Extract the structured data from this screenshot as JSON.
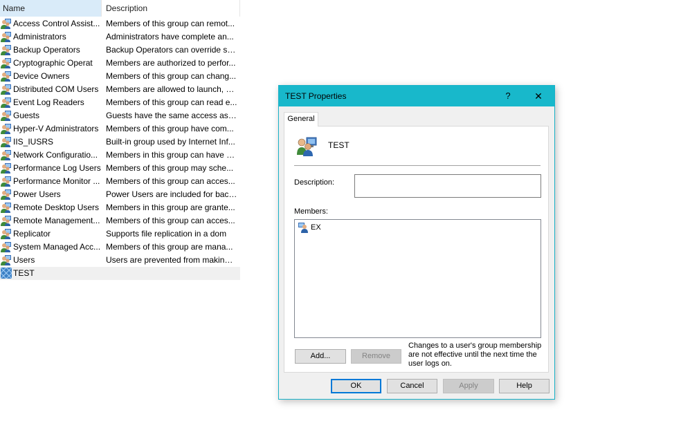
{
  "list": {
    "columns": {
      "name": "Name",
      "description": "Description"
    },
    "rows": [
      {
        "name": "Access Control Assist...",
        "description": "Members of this group can remot..."
      },
      {
        "name": "Administrators",
        "description": "Administrators have complete an..."
      },
      {
        "name": "Backup Operators",
        "description": "Backup Operators can override se..."
      },
      {
        "name": "Cryptographic Operat",
        "description": "Members are authorized to perfor..."
      },
      {
        "name": "Device Owners",
        "description": "Members of this group can chang..."
      },
      {
        "name": "Distributed COM Users",
        "description": "Members are allowed to launch, a..."
      },
      {
        "name": "Event Log Readers",
        "description": "Members of this group can read e..."
      },
      {
        "name": "Guests",
        "description": "Guests have the same access as m..."
      },
      {
        "name": "Hyper-V Administrators",
        "description": "Members of this group have com..."
      },
      {
        "name": "IIS_IUSRS",
        "description": "Built-in group used by Internet Inf..."
      },
      {
        "name": "Network Configuratio...",
        "description": "Members in this group can have s..."
      },
      {
        "name": "Performance Log Users",
        "description": "Members of this group may sche..."
      },
      {
        "name": "Performance Monitor ...",
        "description": "Members of this group can acces..."
      },
      {
        "name": "Power Users",
        "description": "Power Users are included for back..."
      },
      {
        "name": "Remote Desktop Users",
        "description": "Members in this group are grante..."
      },
      {
        "name": "Remote Management...",
        "description": "Members of this group can acces..."
      },
      {
        "name": "Replicator",
        "description": "Supports file replication in a dom"
      },
      {
        "name": "System Managed Acc...",
        "description": "Members of this group are mana..."
      },
      {
        "name": "Users",
        "description": "Users are prevented from making ..."
      },
      {
        "name": "TEST",
        "description": ""
      }
    ],
    "selected_index": 19
  },
  "dialog": {
    "title": "TEST Properties",
    "help_glyph": "?",
    "close_glyph": "✕",
    "tab": "General",
    "group_name": "TEST",
    "description_label": "Description:",
    "description_value": "",
    "members_label": "Members:",
    "members": [
      "EX"
    ],
    "add_label": "Add...",
    "remove_label": "Remove",
    "note": "Changes to a user's group membership are not effective until the next time the user logs on.",
    "ok_label": "OK",
    "cancel_label": "Cancel",
    "apply_label": "Apply",
    "help_label": "Help"
  },
  "colors": {
    "titlebar": "#18b8cb",
    "header_highlight": "#d9ebf9",
    "default_button_border": "#0078d7"
  }
}
